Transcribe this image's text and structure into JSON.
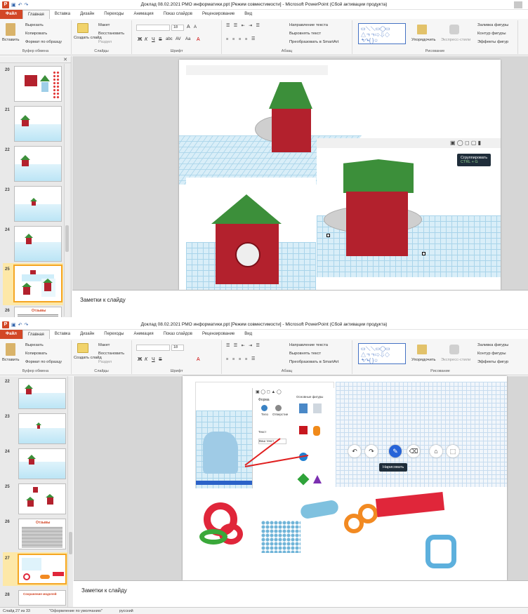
{
  "app": {
    "window_title": "Доклад 08.02.2021 РМО информатики.ppt [Режим совместимости]  -  Microsoft PowerPoint (Сбой активации продукта)",
    "tabs": [
      "Файл",
      "Главная",
      "Вставка",
      "Дизайн",
      "Переходы",
      "Анимация",
      "Показ слайдов",
      "Рецензирование",
      "Вид"
    ],
    "active_tab": "Главная"
  },
  "ribbon": {
    "clipboard": {
      "paste": "Вставить",
      "cut": "Вырезать",
      "copy": "Копировать",
      "format_painter": "Формат по образцу",
      "label": "Буфер обмена"
    },
    "slides": {
      "new_slide": "Создать слайд",
      "layout": "Макет",
      "reset": "Восстановить",
      "section": "Раздел",
      "label": "Слайды"
    },
    "font": {
      "size": "18",
      "label": "Шрифт",
      "bold": "Ж",
      "italic": "К",
      "underline": "Ч",
      "strike": "S",
      "shadow": "abc",
      "spacing": "AV",
      "case": "Aa",
      "grow": "A",
      "shrink": "A",
      "color": "A"
    },
    "paragraph": {
      "text_direction": "Направление текста",
      "align_text": "Выровнять текст",
      "smartart": "Преобразовать в SmartArt",
      "label": "Абзац"
    },
    "drawing": {
      "arrange": "Упорядочить",
      "quick_styles": "Экспресс-стили",
      "label": "Рисование",
      "fill": "Заливка фигуры",
      "outline": "Контур фигуры",
      "effects": "Эффекты фигур"
    }
  },
  "window1": {
    "slides": [
      "20",
      "21",
      "22",
      "23",
      "24",
      "25",
      "26"
    ],
    "selected": "25",
    "tooltip": {
      "title": "Сгруппировать",
      "shortcut": "CTRL + G"
    },
    "notes_placeholder": "Заметки к слайду"
  },
  "window2": {
    "slides": [
      "22",
      "23",
      "24",
      "25",
      "26",
      "27",
      "28"
    ],
    "selected": "27",
    "toolbar_tooltip": "Нарисовать",
    "notes_placeholder": "Заметки к слайду",
    "slide26_title": "Отзывы",
    "slide28_title": "Сохранение моделей",
    "panel": {
      "shapes_label": "Форма",
      "solid": "Тело",
      "hole": "Отверстие",
      "text_label": "Текст",
      "text_value": "Ваш текст",
      "shapes_title": "Основные фигуры"
    }
  },
  "status": {
    "slide_info": "Слайд 27 из 33",
    "theme": "\"Оформление по умолчанию\"",
    "language": "русский"
  },
  "colors": {
    "ppt_accent": "#d24726",
    "roof_green": "#3c8f3a",
    "cube_red": "#b3212d",
    "selection": "#f5a623"
  }
}
